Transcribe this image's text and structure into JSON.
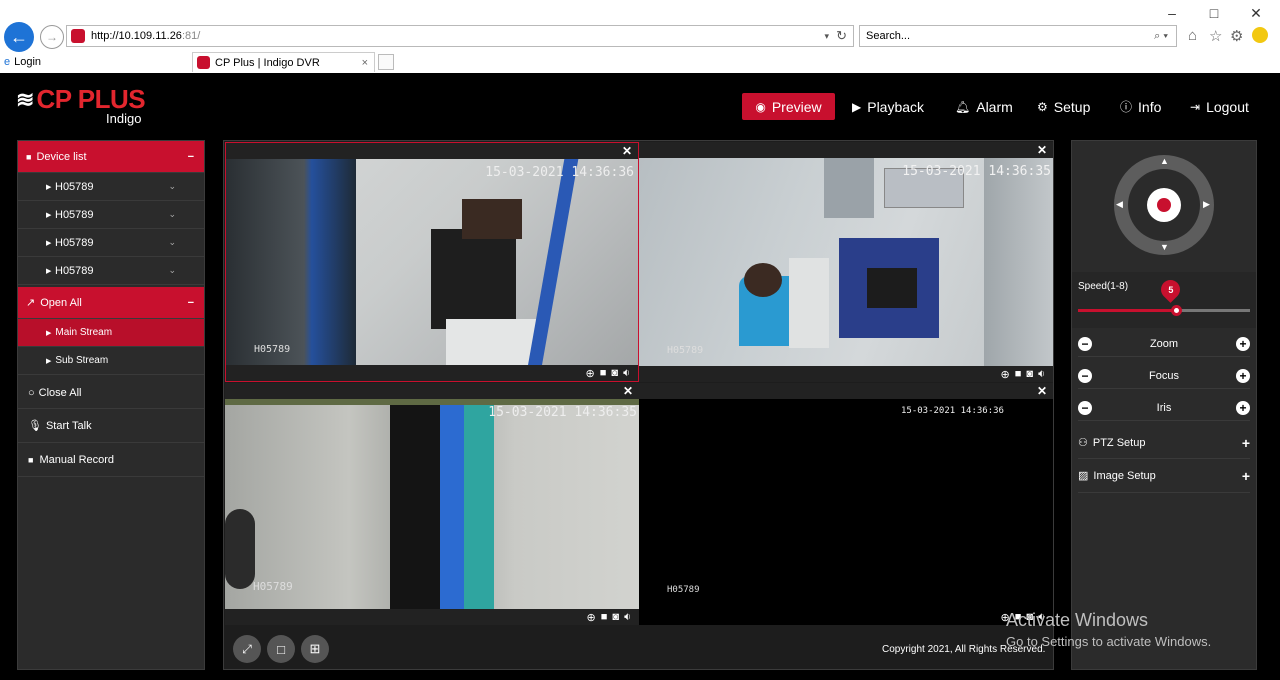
{
  "browser": {
    "url_host": "http://10.109.11.26",
    "url_rest": ":81/",
    "search_placeholder": "Search...",
    "tabs": [
      {
        "label": "Login"
      },
      {
        "label": "CP Plus | Indigo DVR"
      }
    ],
    "window_buttons": {
      "minimize": "–",
      "maximize": "□",
      "close": "✕"
    }
  },
  "brand": {
    "logo": "CP PLUS",
    "sub": "Indigo",
    "accent": "#c8102e"
  },
  "nav": [
    {
      "label": "Preview",
      "icon": "eye-icon"
    },
    {
      "label": "Playback",
      "icon": "play-icon"
    },
    {
      "label": "Alarm",
      "icon": "bell-icon"
    },
    {
      "label": "Setup",
      "icon": "gear-icon"
    },
    {
      "label": "Info",
      "icon": "info-icon"
    },
    {
      "label": "Logout",
      "icon": "logout-icon"
    }
  ],
  "sidebar": {
    "device_list": "Device list",
    "devices": [
      "H05789",
      "H05789",
      "H05789",
      "H05789"
    ],
    "open_all": "Open All",
    "main_stream": "Main Stream",
    "sub_stream": "Sub Stream",
    "close_all": "Close All",
    "start_talk": "Start Talk",
    "manual_record": "Manual Record"
  },
  "cameras": [
    {
      "timestamp": "15-03-2021 14:36:36",
      "id": "H05789"
    },
    {
      "timestamp": "15-03-2021 14:36:35",
      "id": "H05789"
    },
    {
      "timestamp": "15-03-2021 14:36:35",
      "id": "H05789"
    },
    {
      "timestamp": "15-03-2021 14:36:36",
      "id": "H05789"
    }
  ],
  "footer": {
    "copyright": "Copyright 2021, All Rights Reserved."
  },
  "ptz": {
    "speed_label": "Speed(1-8)",
    "speed_value": "5",
    "speed_fraction": 0.57,
    "zoom": "Zoom",
    "focus": "Focus",
    "iris": "Iris",
    "ptz_setup": "PTZ Setup",
    "image_setup": "Image Setup"
  },
  "watermark": {
    "title": "Activate Windows",
    "subtitle": "Go to Settings to activate Windows."
  }
}
